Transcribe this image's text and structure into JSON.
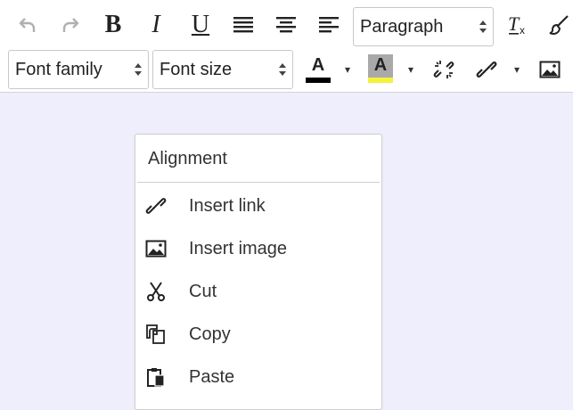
{
  "toolbar": {
    "row1": {
      "undo_icon": "undo-icon",
      "redo_icon": "redo-icon",
      "bold_glyph": "B",
      "italic_glyph": "I",
      "underline_glyph": "U",
      "block_format": {
        "value": "Paragraph"
      }
    },
    "row2": {
      "font_family": {
        "value": "Font family"
      },
      "font_size": {
        "value": "Font size"
      },
      "text_color_glyph": "A",
      "text_color": "#000000",
      "background_color_glyph": "A",
      "background_color": "#f5f23b"
    }
  },
  "context_menu": {
    "header": "Alignment",
    "items": [
      {
        "label": "Insert link",
        "icon": "link-icon"
      },
      {
        "label": "Insert image",
        "icon": "image-icon"
      },
      {
        "label": "Cut",
        "icon": "scissors-icon"
      },
      {
        "label": "Copy",
        "icon": "copy-icon"
      },
      {
        "label": "Paste",
        "icon": "paste-icon"
      }
    ]
  },
  "colors": {
    "editor_background": "#eeeefc",
    "toolbar_background": "#ffffff",
    "disabled_icon": "#b0b0b0"
  }
}
